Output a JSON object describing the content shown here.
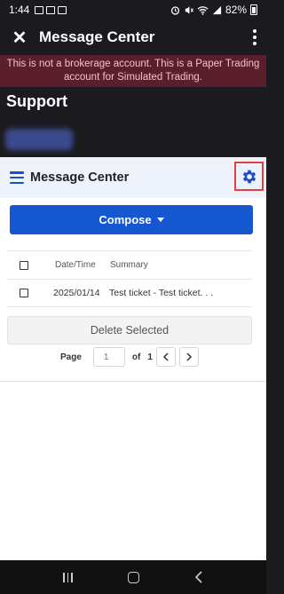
{
  "status_bar": {
    "time": "1:44",
    "battery": "82%"
  },
  "app_bar": {
    "title": "Message Center"
  },
  "banner": {
    "text": "This is not a brokerage account. This is a Paper Trading account for Simulated Trading."
  },
  "support": {
    "title": "Support"
  },
  "message_center": {
    "title": "Message Center",
    "compose_label": "Compose",
    "table": {
      "columns": [
        "Date/Time",
        "Summary"
      ],
      "rows": [
        {
          "date": "2025/01/14",
          "summary": "Test ticket - Test ticket. . ."
        }
      ]
    },
    "delete_label": "Delete Selected",
    "pagination": {
      "page_label": "Page",
      "page_placeholder": "1",
      "of_label": "of",
      "total_pages": "1"
    }
  },
  "colors": {
    "accent": "#1557d0",
    "banner_bg": "#5a1f2a",
    "highlight_border": "#e04040"
  }
}
